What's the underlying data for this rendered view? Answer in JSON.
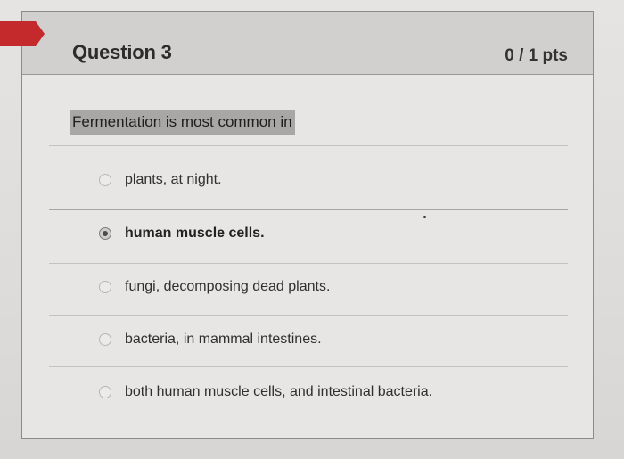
{
  "question": {
    "title": "Question 3",
    "points": "0 / 1 pts",
    "prompt": "Fermentation is most common in"
  },
  "answers": [
    {
      "label": "plants, at night.",
      "selected": false
    },
    {
      "label": "human muscle cells.",
      "selected": true
    },
    {
      "label": "fungi, decomposing dead plants.",
      "selected": false
    },
    {
      "label": "bacteria, in mammal intestines.",
      "selected": false
    },
    {
      "label": "both human muscle cells, and intestinal bacteria.",
      "selected": false
    }
  ],
  "colors": {
    "flag": "#c42a2c",
    "header_bg": "#d2d0ce",
    "prompt_highlight": "#a9a7a6"
  }
}
